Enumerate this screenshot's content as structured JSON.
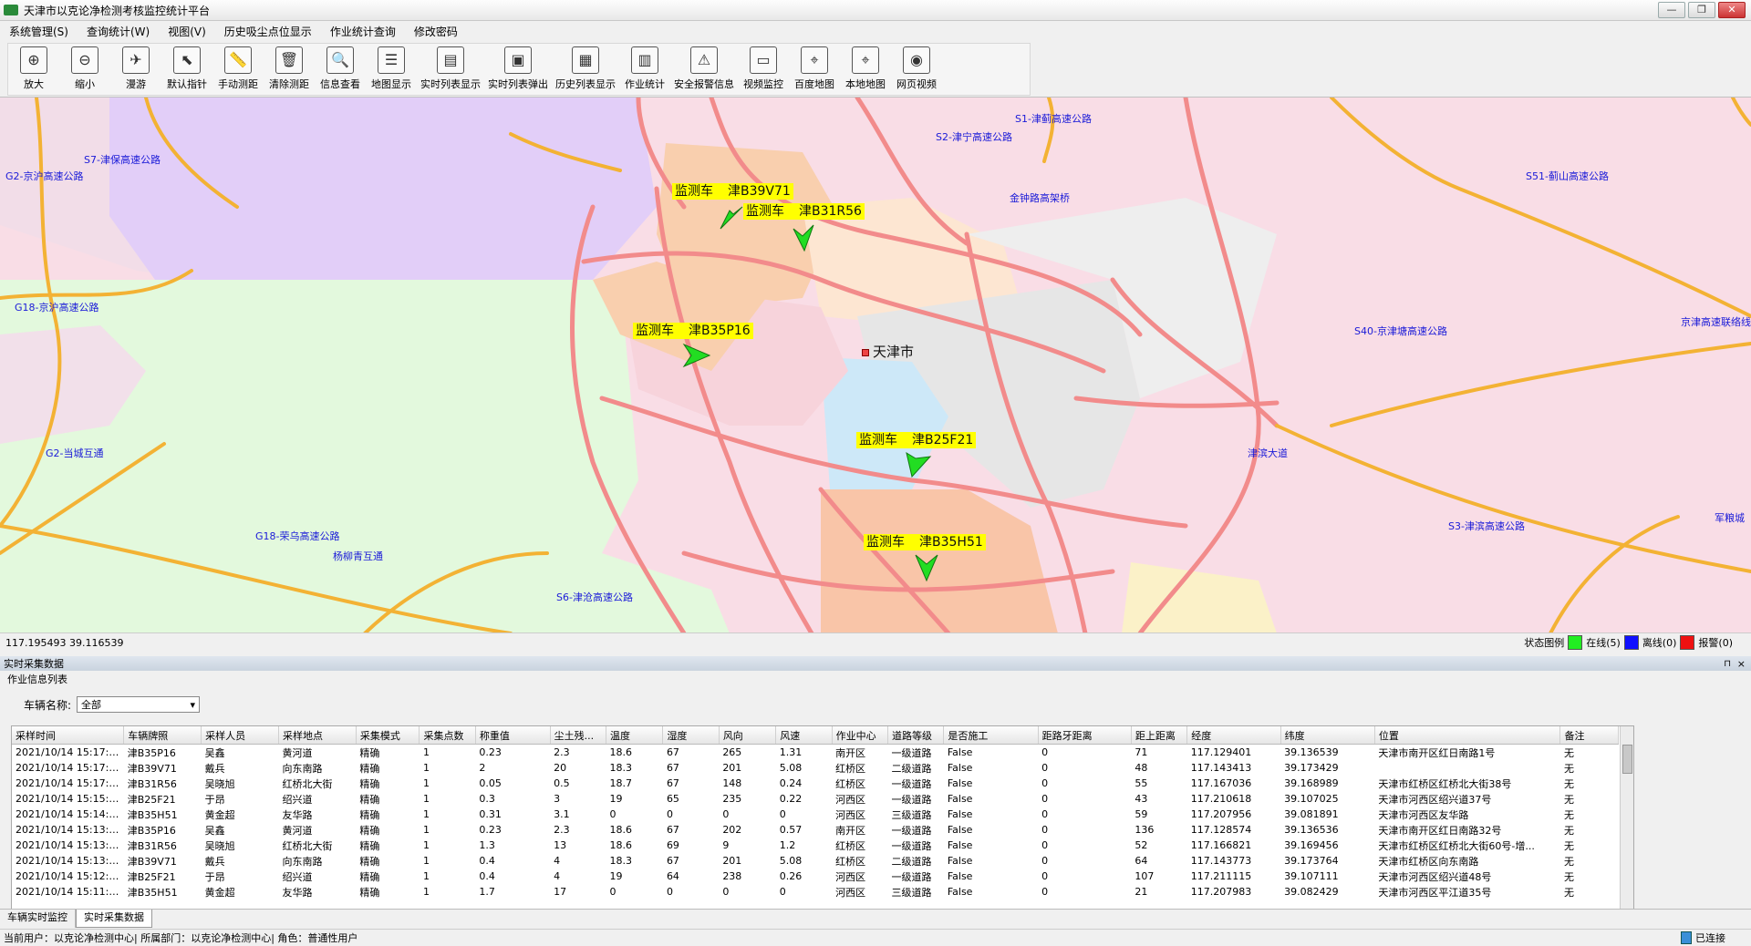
{
  "window": {
    "title": "天津市以克论净检测考核监控统计平台",
    "min": "0",
    "max": "1",
    "close": "r"
  },
  "menu": [
    "系统管理(S)",
    "查询统计(W)",
    "视图(V)",
    "历史吸尘点位显示",
    "作业统计查询",
    "修改密码"
  ],
  "toolbar": [
    {
      "label": "放大",
      "icon": "zoom-in-icon",
      "glyph": "⊕"
    },
    {
      "label": "缩小",
      "icon": "zoom-out-icon",
      "glyph": "⊖"
    },
    {
      "label": "漫游",
      "icon": "pan-icon",
      "glyph": "✈"
    },
    {
      "label": "默认指针",
      "icon": "pointer-icon",
      "glyph": "⬉"
    },
    {
      "label": "手动测距",
      "icon": "ruler-icon",
      "glyph": "📏"
    },
    {
      "label": "清除测距",
      "icon": "clear-icon",
      "glyph": "🗑"
    },
    {
      "label": "信息查看",
      "icon": "info-icon",
      "glyph": "🔍"
    },
    {
      "label": "地图显示",
      "icon": "map-layers-icon",
      "glyph": "☰"
    },
    {
      "label": "实时列表显示",
      "icon": "list-icon",
      "glyph": "▤"
    },
    {
      "label": "实时列表弹出",
      "icon": "popup-icon",
      "glyph": "▣"
    },
    {
      "label": "历史列表显示",
      "icon": "history-icon",
      "glyph": "▦"
    },
    {
      "label": "作业统计",
      "icon": "chart-icon",
      "glyph": "▥"
    },
    {
      "label": "安全报警信息",
      "icon": "alarm-icon",
      "glyph": "⚠"
    },
    {
      "label": "视频监控",
      "icon": "video-icon",
      "glyph": "▭"
    },
    {
      "label": "百度地图",
      "icon": "baidu-map-icon",
      "glyph": "⌖"
    },
    {
      "label": "本地地图",
      "icon": "local-map-icon",
      "glyph": "⌖"
    },
    {
      "label": "网页视频",
      "icon": "web-video-icon",
      "glyph": "◉"
    }
  ],
  "map": {
    "city": "天津市",
    "road_labels": [
      "S1-津蓟高速公路",
      "S2-津宁高速公路",
      "S7-津保高速公路",
      "G2-京沪高速公路",
      "S51-蓟山高速公路",
      "金钟路高架桥",
      "G18-京沪高速公路",
      "S40-京津塘高速公路",
      "京津高速联络线",
      "G2-当城互通",
      "津滨大道",
      "S3-津滨高速公路",
      "G18-荣乌高速公路",
      "杨柳青互通",
      "S6-津沧高速公路",
      "军粮城"
    ],
    "vehicles": [
      {
        "type": "监测车",
        "plate": "津B39V71"
      },
      {
        "type": "监测车",
        "plate": "津B31R56"
      },
      {
        "type": "监测车",
        "plate": "津B35P16"
      },
      {
        "type": "监测车",
        "plate": "津B25F21"
      },
      {
        "type": "监测车",
        "plate": "津B35H51"
      }
    ],
    "coords": "117.195493  39.116539",
    "legend_title": "状态图例",
    "legend": [
      {
        "label": "在线(5)",
        "color": "#22ee22"
      },
      {
        "label": "离线(0)",
        "color": "#1010ff"
      },
      {
        "label": "报警(0)",
        "color": "#ee1111"
      }
    ]
  },
  "panel": {
    "title": "实时采集数据",
    "pin": "⊓",
    "close": "×",
    "subtitle": "作业信息列表",
    "filter_label": "车辆名称:",
    "filter_value": "全部",
    "columns": [
      "采样时间",
      "车辆牌照",
      "采样人员",
      "采样地点",
      "采集模式",
      "采集点数",
      "称重值",
      "尘土残...",
      "温度",
      "湿度",
      "风向",
      "风速",
      "作业中心",
      "道路等级",
      "是否施工",
      "距路牙距离",
      "距上距离",
      "经度",
      "纬度",
      "位置",
      "备注"
    ],
    "rows": [
      [
        "2021/10/14 15:17:46",
        "津B35P16",
        "吴鑫",
        "黄河道",
        "精确",
        "1",
        "0.23",
        "2.3",
        "18.6",
        "67",
        "265",
        "1.31",
        "南开区",
        "一级道路",
        "False",
        "0",
        "71",
        "117.129401",
        "39.136539",
        "天津市南开区红日南路1号",
        "无"
      ],
      [
        "2021/10/14 15:17:25",
        "津B39V71",
        "戴兵",
        "向东南路",
        "精确",
        "1",
        "2",
        "20",
        "18.3",
        "67",
        "201",
        "5.08",
        "红桥区",
        "二级道路",
        "False",
        "0",
        "48",
        "117.143413",
        "39.173429",
        "",
        "无"
      ],
      [
        "2021/10/14 15:17:17",
        "津B31R56",
        "吴晓旭",
        "红桥北大街",
        "精确",
        "1",
        "0.05",
        "0.5",
        "18.7",
        "67",
        "148",
        "0.24",
        "红桥区",
        "一级道路",
        "False",
        "0",
        "55",
        "117.167036",
        "39.168989",
        "天津市红桥区红桥北大街38号",
        "无"
      ],
      [
        "2021/10/14 15:15:48",
        "津B25F21",
        "于昂",
        "绍兴道",
        "精确",
        "1",
        "0.3",
        "3",
        "19",
        "65",
        "235",
        "0.22",
        "河西区",
        "一级道路",
        "False",
        "0",
        "43",
        "117.210618",
        "39.107025",
        "天津市河西区绍兴道37号",
        "无"
      ],
      [
        "2021/10/14 15:14:54",
        "津B35H51",
        "黄金超",
        "友华路",
        "精确",
        "1",
        "0.31",
        "3.1",
        "0",
        "0",
        "0",
        "0",
        "河西区",
        "三级道路",
        "False",
        "0",
        "59",
        "117.207956",
        "39.081891",
        "天津市河西区友华路",
        "无"
      ],
      [
        "2021/10/14 15:13:59",
        "津B35P16",
        "吴鑫",
        "黄河道",
        "精确",
        "1",
        "0.23",
        "2.3",
        "18.6",
        "67",
        "202",
        "0.57",
        "南开区",
        "一级道路",
        "False",
        "0",
        "136",
        "117.128574",
        "39.136536",
        "天津市南开区红日南路32号",
        "无"
      ],
      [
        "2021/10/14 15:13:37",
        "津B31R56",
        "吴晓旭",
        "红桥北大街",
        "精确",
        "1",
        "1.3",
        "13",
        "18.6",
        "69",
        "9",
        "1.2",
        "红桥区",
        "一级道路",
        "False",
        "0",
        "52",
        "117.166821",
        "39.169456",
        "天津市红桥区红桥北大街60号-增...",
        "无"
      ],
      [
        "2021/10/14 15:13:36",
        "津B39V71",
        "戴兵",
        "向东南路",
        "精确",
        "1",
        "0.4",
        "4",
        "18.3",
        "67",
        "201",
        "5.08",
        "红桥区",
        "二级道路",
        "False",
        "0",
        "64",
        "117.143773",
        "39.173764",
        "天津市红桥区向东南路",
        "无"
      ],
      [
        "2021/10/14 15:12:05",
        "津B25F21",
        "于昂",
        "绍兴道",
        "精确",
        "1",
        "0.4",
        "4",
        "19",
        "64",
        "238",
        "0.26",
        "河西区",
        "一级道路",
        "False",
        "0",
        "107",
        "117.211115",
        "39.107111",
        "天津市河西区绍兴道48号",
        "无"
      ],
      [
        "2021/10/14 15:11:04",
        "津B35H51",
        "黄金超",
        "友华路",
        "精确",
        "1",
        "1.7",
        "17",
        "0",
        "0",
        "0",
        "0",
        "河西区",
        "三级道路",
        "False",
        "0",
        "21",
        "117.207983",
        "39.082429",
        "天津市河西区平江道35号",
        "无"
      ]
    ]
  },
  "tabs": [
    "车辆实时监控",
    "实时采集数据"
  ],
  "status": {
    "user": "当前用户：以克论净检测中心| 所属部门：以克论净检测中心| 角色：普通性用户",
    "connection": "已连接"
  }
}
